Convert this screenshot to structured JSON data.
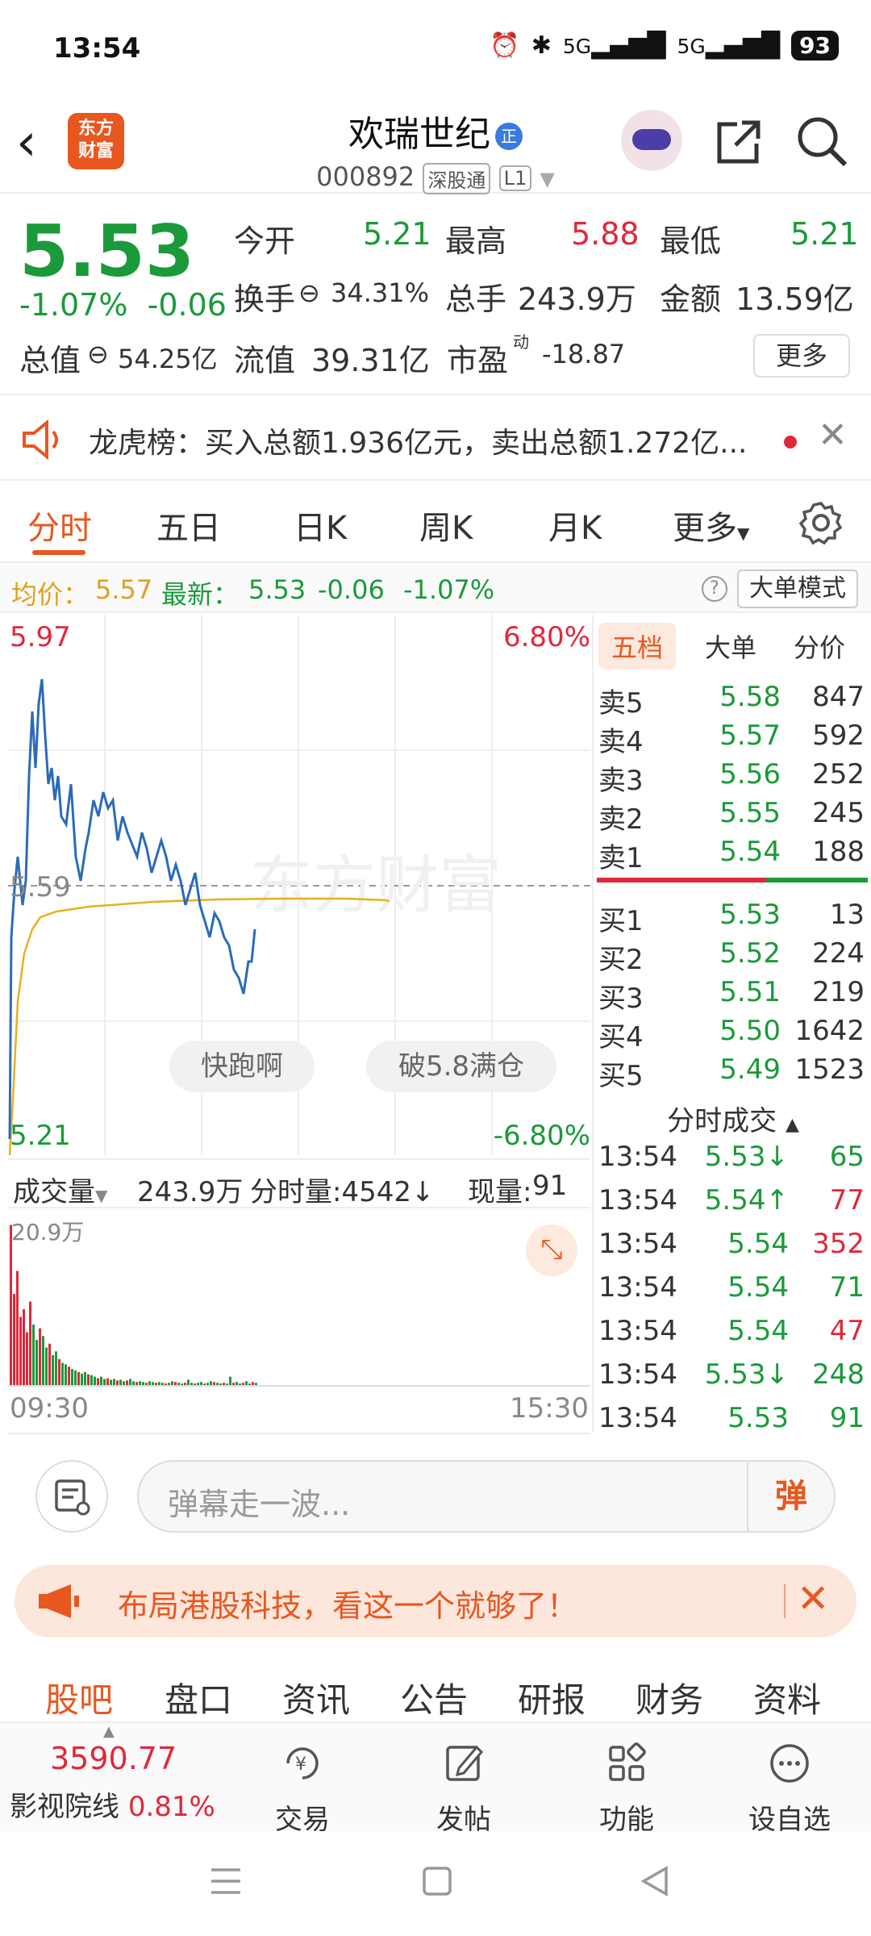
{
  "status_bar": {
    "time": "13:54",
    "network": "5G",
    "battery": "93"
  },
  "header": {
    "logo_line1": "东方",
    "logo_line2": "财富",
    "title": "欢瑞世纪",
    "title_badge": "正",
    "code": "000892",
    "tag1": "深股通",
    "tag2": "L1"
  },
  "quote": {
    "price": "5.53",
    "change_pct": "-1.07%",
    "change": "-0.06",
    "open_label": "今开",
    "open": "5.21",
    "high_label": "最高",
    "high": "5.88",
    "low_label": "最低",
    "low": "5.21",
    "turnover_label": "换手",
    "turnover": "34.31%",
    "volume_label": "总手",
    "volume": "243.9万",
    "amount_label": "金额",
    "amount": "13.59亿",
    "mcap_label": "总值",
    "mcap": "54.25亿",
    "float_label": "流值",
    "float": "39.31亿",
    "pe_label": "市盈",
    "pe_sup": "动",
    "pe": "-18.87",
    "more": "更多"
  },
  "banner": {
    "text": "龙虎榜：买入总额1.936亿元，卖出总额1.272亿..."
  },
  "tabs": [
    "分时",
    "五日",
    "日K",
    "周K",
    "月K",
    "更多"
  ],
  "info": {
    "avg_label": "均价：",
    "avg": "5.57",
    "latest_label": "最新：",
    "latest": "5.53",
    "latest_chg": "-0.06",
    "latest_pct": "-1.07%",
    "big_mode": "大单模式"
  },
  "chart": {
    "top_price": "5.97",
    "top_pct": "6.80%",
    "mid_price": "5.59",
    "bottom_price": "5.21",
    "bottom_pct": "-6.80%",
    "watermark": "东方财富",
    "bubble1": "快跑啊",
    "bubble2": "破5.8满仓",
    "vol_label": "成交量",
    "vol_total": "243.9万",
    "vol_fenshi": "分时量:4542↓",
    "vol_now_label": "现量:",
    "vol_now": "91",
    "vol_max": "20.9万",
    "time_start": "09:30",
    "time_end": "15:30"
  },
  "book": {
    "tabs": [
      "五档",
      "大单",
      "分价"
    ],
    "asks": [
      {
        "name": "卖5",
        "price": "5.58",
        "vol": "847"
      },
      {
        "name": "卖4",
        "price": "5.57",
        "vol": "592"
      },
      {
        "name": "卖3",
        "price": "5.56",
        "vol": "252"
      },
      {
        "name": "卖2",
        "price": "5.55",
        "vol": "245"
      },
      {
        "name": "卖1",
        "price": "5.54",
        "vol": "188"
      }
    ],
    "bids": [
      {
        "name": "买1",
        "price": "5.53",
        "vol": "13"
      },
      {
        "name": "买2",
        "price": "5.52",
        "vol": "224"
      },
      {
        "name": "买3",
        "price": "5.51",
        "vol": "219"
      },
      {
        "name": "买4",
        "price": "5.50",
        "vol": "1642"
      },
      {
        "name": "买5",
        "price": "5.49",
        "vol": "1523"
      }
    ],
    "trades_title": "分时成交",
    "trades": [
      {
        "time": "13:54",
        "price": "5.53↓",
        "vol": "65"
      },
      {
        "time": "13:54",
        "price": "5.54↑",
        "vol": "77"
      },
      {
        "time": "13:54",
        "price": "5.54",
        "vol": "352"
      },
      {
        "time": "13:54",
        "price": "5.54",
        "vol": "71"
      },
      {
        "time": "13:54",
        "price": "5.54",
        "vol": "47"
      },
      {
        "time": "13:54",
        "price": "5.53↓",
        "vol": "248"
      },
      {
        "time": "13:54",
        "price": "5.53",
        "vol": "91"
      }
    ]
  },
  "comment": {
    "placeholder": "弹幕走一波...",
    "send": "弹"
  },
  "ad": {
    "text": "布局港股科技，看这一个就够了！"
  },
  "bottom_tabs": [
    "股吧",
    "盘口",
    "资讯",
    "公告",
    "研报",
    "财务",
    "资料"
  ],
  "bottom_nav": {
    "index_value": "3590.77",
    "index_name": "影视院线",
    "index_pct": "0.81%",
    "items": [
      "交易",
      "发帖",
      "功能",
      "设自选"
    ]
  },
  "colors": {
    "up": "#e0283a",
    "down": "#1a9a3a",
    "accent": "#e8571f"
  }
}
